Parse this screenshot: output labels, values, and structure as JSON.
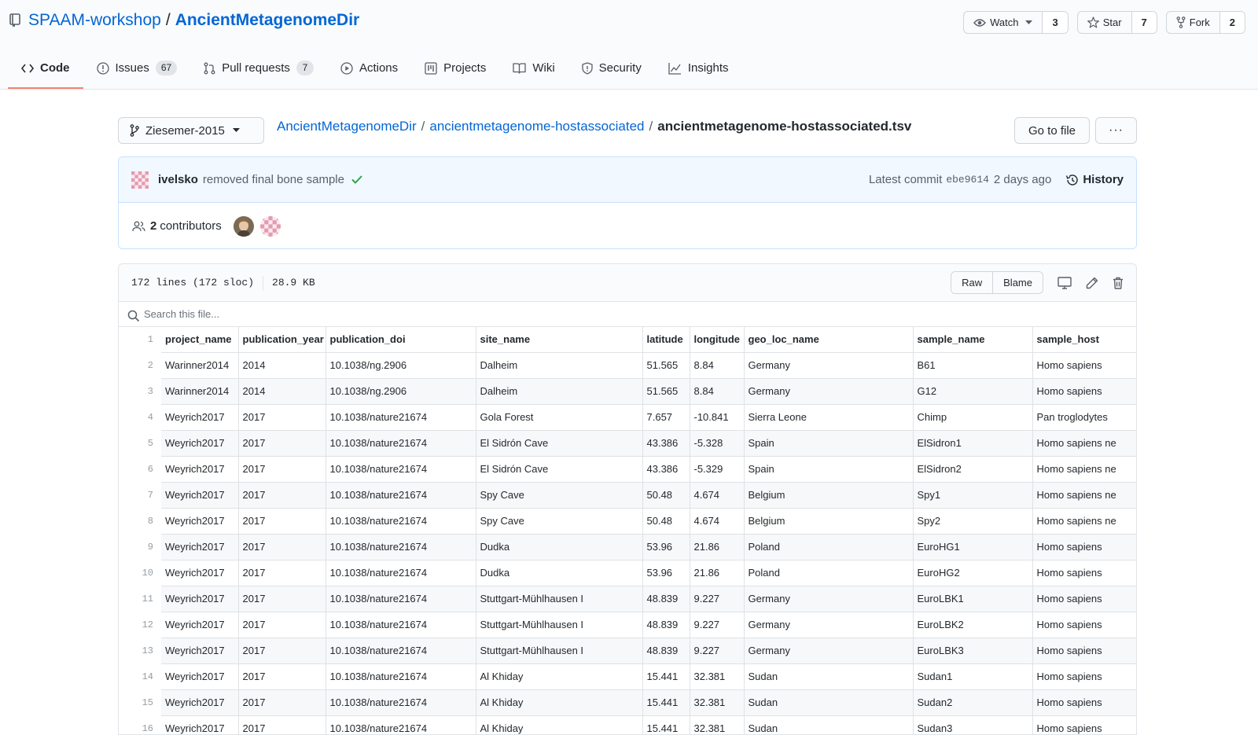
{
  "repo": {
    "owner": "SPAAM-workshop",
    "name": "AncientMetagenomeDir"
  },
  "actions": [
    {
      "label": "Watch",
      "count": "3"
    },
    {
      "label": "Star",
      "count": "7"
    },
    {
      "label": "Fork",
      "count": "2"
    }
  ],
  "tabs": [
    {
      "label": "Code"
    },
    {
      "label": "Issues",
      "count": "67"
    },
    {
      "label": "Pull requests",
      "count": "7"
    },
    {
      "label": "Actions"
    },
    {
      "label": "Projects"
    },
    {
      "label": "Wiki"
    },
    {
      "label": "Security"
    },
    {
      "label": "Insights"
    }
  ],
  "branch": "Ziesemer-2015",
  "breadcrumb": {
    "root": "AncientMetagenomeDir",
    "folder": "ancientmetagenome-hostassociated",
    "file": "ancientmetagenome-hostassociated.tsv"
  },
  "buttons": {
    "go_to_file": "Go to file",
    "more": "···"
  },
  "commit": {
    "author": "ivelsko",
    "message": "removed final bone sample",
    "latest_label": "Latest commit",
    "sha": "ebe9614",
    "time": "2 days ago",
    "history_label": "History"
  },
  "contributors": {
    "count": "2",
    "label": "contributors"
  },
  "file": {
    "lines": "172 lines (172 sloc)",
    "size": "28.9 KB",
    "raw_label": "Raw",
    "blame_label": "Blame",
    "search_placeholder": "Search this file..."
  },
  "table": {
    "columns": [
      "project_name",
      "publication_year",
      "publication_doi",
      "site_name",
      "latitude",
      "longitude",
      "geo_loc_name",
      "sample_name",
      "sample_host"
    ],
    "rows": [
      [
        "Warinner2014",
        "2014",
        "10.1038/ng.2906",
        "Dalheim",
        "51.565",
        "8.84",
        "Germany",
        "B61",
        "Homo sapiens"
      ],
      [
        "Warinner2014",
        "2014",
        "10.1038/ng.2906",
        "Dalheim",
        "51.565",
        "8.84",
        "Germany",
        "G12",
        "Homo sapiens"
      ],
      [
        "Weyrich2017",
        "2017",
        "10.1038/nature21674",
        "Gola Forest",
        "7.657",
        "-10.841",
        "Sierra Leone",
        "Chimp",
        "Pan troglodytes"
      ],
      [
        "Weyrich2017",
        "2017",
        "10.1038/nature21674",
        "El Sidrón Cave",
        "43.386",
        "-5.328",
        "Spain",
        "ElSidron1",
        "Homo sapiens ne"
      ],
      [
        "Weyrich2017",
        "2017",
        "10.1038/nature21674",
        "El Sidrón Cave",
        "43.386",
        "-5.329",
        "Spain",
        "ElSidron2",
        "Homo sapiens ne"
      ],
      [
        "Weyrich2017",
        "2017",
        "10.1038/nature21674",
        "Spy Cave",
        "50.48",
        "4.674",
        "Belgium",
        "Spy1",
        "Homo sapiens ne"
      ],
      [
        "Weyrich2017",
        "2017",
        "10.1038/nature21674",
        "Spy Cave",
        "50.48",
        "4.674",
        "Belgium",
        "Spy2",
        "Homo sapiens ne"
      ],
      [
        "Weyrich2017",
        "2017",
        "10.1038/nature21674",
        "Dudka",
        "53.96",
        "21.86",
        "Poland",
        "EuroHG1",
        "Homo sapiens"
      ],
      [
        "Weyrich2017",
        "2017",
        "10.1038/nature21674",
        "Dudka",
        "53.96",
        "21.86",
        "Poland",
        "EuroHG2",
        "Homo sapiens"
      ],
      [
        "Weyrich2017",
        "2017",
        "10.1038/nature21674",
        "Stuttgart-Mühlhausen I",
        "48.839",
        "9.227",
        "Germany",
        "EuroLBK1",
        "Homo sapiens"
      ],
      [
        "Weyrich2017",
        "2017",
        "10.1038/nature21674",
        "Stuttgart-Mühlhausen I",
        "48.839",
        "9.227",
        "Germany",
        "EuroLBK2",
        "Homo sapiens"
      ],
      [
        "Weyrich2017",
        "2017",
        "10.1038/nature21674",
        "Stuttgart-Mühlhausen I",
        "48.839",
        "9.227",
        "Germany",
        "EuroLBK3",
        "Homo sapiens"
      ],
      [
        "Weyrich2017",
        "2017",
        "10.1038/nature21674",
        "Al Khiday",
        "15.441",
        "32.381",
        "Sudan",
        "Sudan1",
        "Homo sapiens"
      ],
      [
        "Weyrich2017",
        "2017",
        "10.1038/nature21674",
        "Al Khiday",
        "15.441",
        "32.381",
        "Sudan",
        "Sudan2",
        "Homo sapiens"
      ],
      [
        "Weyrich2017",
        "2017",
        "10.1038/nature21674",
        "Al Khiday",
        "15.441",
        "32.381",
        "Sudan",
        "Sudan3",
        "Homo sapiens"
      ]
    ]
  },
  "colors": {
    "link": "#0366d6",
    "active_tab": "#f9826c",
    "check": "#28a745"
  }
}
